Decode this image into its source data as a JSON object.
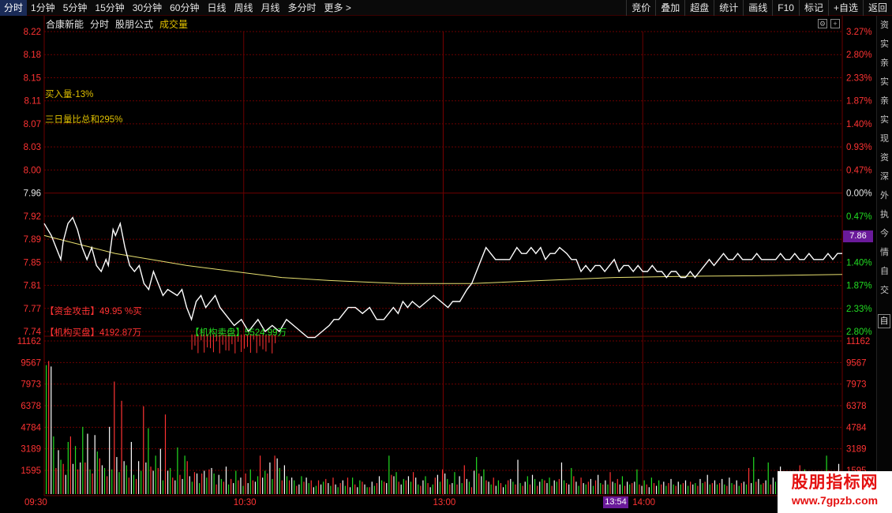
{
  "toolbar": {
    "tabs": [
      {
        "label": "分时",
        "active": true
      },
      {
        "label": "1分钟"
      },
      {
        "label": "5分钟"
      },
      {
        "label": "15分钟"
      },
      {
        "label": "30分钟"
      },
      {
        "label": "60分钟"
      },
      {
        "label": "日线"
      },
      {
        "label": "周线"
      },
      {
        "label": "月线"
      },
      {
        "label": "多分时"
      },
      {
        "label": "更多 >"
      }
    ],
    "tools": [
      "竞价",
      "叠加",
      "超盘",
      "统计",
      "画线",
      "F10",
      "标记",
      "+自选",
      "返回"
    ]
  },
  "title": {
    "stock_name": "合康新能",
    "view": "分时",
    "formula": "股朋公式",
    "indicator": "成交量"
  },
  "annotations": {
    "buy_in": "买入量-13%",
    "three_day": "三日量比总和295%",
    "fund_attack": "【资金攻击】49.95 %买",
    "inst_buy": "【机构买盘】4192.87万",
    "inst_sell": "【机构卖盘】5524.99万"
  },
  "current_price_label": "7.86",
  "cursor_time_label": "13:54",
  "right_strip_text": "资 实 亲 实 亲 实 现 资 深 外 执 今 情 自 交",
  "right_strip_tab": "自",
  "watermark": {
    "title": "股朋指标网",
    "url": "www.7gpzb.com"
  },
  "colors": {
    "background": "#000000",
    "grid": "#6b0000",
    "price_line": "#ffffff",
    "avg_line": "#e8e070",
    "up": "#ff3333",
    "down": "#22dd22",
    "label_price": "#ff3333",
    "label_ref": "#e6e6e6",
    "accent": "#6a1a9a"
  },
  "chart_data": [
    {
      "type": "line",
      "name": "price",
      "yticks_left": [
        "8.22",
        "8.18",
        "8.15",
        "8.11",
        "8.07",
        "8.03",
        "8.00",
        "7.96",
        "7.92",
        "7.89",
        "7.85",
        "7.81",
        "7.77",
        "7.74"
      ],
      "yticks_right": [
        "3.27%",
        "2.80%",
        "2.33%",
        "1.87%",
        "1.40%",
        "0.93%",
        "0.47%",
        "0.00%",
        "0.47%",
        "0.93%",
        "1.40%",
        "1.87%",
        "2.33%",
        "2.80%"
      ],
      "reference_price": 7.96,
      "ylim": [
        7.72,
        8.22
      ],
      "x_ticks": [
        "09:30",
        "10:30",
        "13:00",
        "14:00"
      ],
      "series": [
        {
          "name": "price",
          "points_minute_price": [
            [
              0,
              7.9
            ],
            [
              3,
              7.88
            ],
            [
              5,
              7.86
            ],
            [
              7,
              7.84
            ],
            [
              8,
              7.87
            ],
            [
              10,
              7.9
            ],
            [
              12,
              7.91
            ],
            [
              14,
              7.89
            ],
            [
              16,
              7.86
            ],
            [
              18,
              7.84
            ],
            [
              20,
              7.86
            ],
            [
              22,
              7.83
            ],
            [
              24,
              7.82
            ],
            [
              26,
              7.84
            ],
            [
              27,
              7.83
            ],
            [
              29,
              7.89
            ],
            [
              30,
              7.88
            ],
            [
              32,
              7.9
            ],
            [
              34,
              7.86
            ],
            [
              36,
              7.83
            ],
            [
              38,
              7.82
            ],
            [
              40,
              7.83
            ],
            [
              42,
              7.8
            ],
            [
              44,
              7.79
            ],
            [
              46,
              7.82
            ],
            [
              48,
              7.8
            ],
            [
              50,
              7.78
            ],
            [
              52,
              7.79
            ],
            [
              56,
              7.78
            ],
            [
              58,
              7.79
            ],
            [
              60,
              7.76
            ],
            [
              62,
              7.74
            ],
            [
              64,
              7.77
            ],
            [
              66,
              7.78
            ],
            [
              68,
              7.76
            ],
            [
              70,
              7.77
            ],
            [
              72,
              7.78
            ],
            [
              74,
              7.76
            ],
            [
              76,
              7.75
            ],
            [
              78,
              7.74
            ],
            [
              80,
              7.73
            ],
            [
              83,
              7.74
            ],
            [
              86,
              7.72
            ],
            [
              88,
              7.73
            ],
            [
              90,
              7.74
            ],
            [
              93,
              7.72
            ],
            [
              96,
              7.73
            ],
            [
              99,
              7.72
            ],
            [
              102,
              7.74
            ],
            [
              105,
              7.73
            ],
            [
              108,
              7.72
            ],
            [
              111,
              7.71
            ],
            [
              114,
              7.71
            ],
            [
              117,
              7.72
            ],
            [
              120,
              7.73
            ],
            [
              122,
              7.74
            ],
            [
              124,
              7.74
            ],
            [
              126,
              7.75
            ],
            [
              128,
              7.76
            ],
            [
              131,
              7.76
            ],
            [
              134,
              7.75
            ],
            [
              137,
              7.76
            ],
            [
              140,
              7.74
            ],
            [
              143,
              7.74
            ],
            [
              145,
              7.75
            ],
            [
              147,
              7.76
            ],
            [
              149,
              7.75
            ],
            [
              151,
              7.77
            ],
            [
              153,
              7.76
            ],
            [
              155,
              7.77
            ],
            [
              158,
              7.76
            ],
            [
              161,
              7.77
            ],
            [
              164,
              7.78
            ],
            [
              167,
              7.77
            ],
            [
              170,
              7.76
            ],
            [
              172,
              7.77
            ],
            [
              175,
              7.77
            ],
            [
              178,
              7.79
            ],
            [
              180,
              7.8
            ],
            [
              182,
              7.82
            ],
            [
              184,
              7.84
            ],
            [
              186,
              7.86
            ],
            [
              188,
              7.85
            ],
            [
              190,
              7.84
            ],
            [
              193,
              7.84
            ],
            [
              196,
              7.84
            ],
            [
              199,
              7.86
            ],
            [
              201,
              7.85
            ],
            [
              203,
              7.85
            ],
            [
              205,
              7.86
            ],
            [
              207,
              7.85
            ],
            [
              209,
              7.86
            ],
            [
              211,
              7.84
            ],
            [
              213,
              7.85
            ],
            [
              215,
              7.85
            ],
            [
              217,
              7.86
            ],
            [
              220,
              7.85
            ],
            [
              222,
              7.84
            ],
            [
              224,
              7.84
            ],
            [
              226,
              7.82
            ],
            [
              228,
              7.83
            ],
            [
              230,
              7.82
            ],
            [
              232,
              7.83
            ],
            [
              234,
              7.83
            ],
            [
              236,
              7.82
            ],
            [
              238,
              7.83
            ],
            [
              240,
              7.84
            ],
            [
              242,
              7.82
            ],
            [
              244,
              7.83
            ],
            [
              246,
              7.83
            ],
            [
              248,
              7.82
            ],
            [
              250,
              7.83
            ],
            [
              252,
              7.82
            ],
            [
              254,
              7.82
            ],
            [
              256,
              7.83
            ],
            [
              258,
              7.82
            ],
            [
              260,
              7.82
            ],
            [
              262,
              7.81
            ],
            [
              264,
              7.82
            ],
            [
              266,
              7.82
            ],
            [
              268,
              7.81
            ],
            [
              270,
              7.81
            ],
            [
              272,
              7.82
            ],
            [
              274,
              7.81
            ],
            [
              276,
              7.82
            ],
            [
              278,
              7.83
            ],
            [
              280,
              7.84
            ],
            [
              282,
              7.83
            ],
            [
              284,
              7.84
            ],
            [
              286,
              7.85
            ],
            [
              288,
              7.84
            ],
            [
              290,
              7.84
            ],
            [
              292,
              7.85
            ],
            [
              294,
              7.84
            ],
            [
              296,
              7.84
            ],
            [
              298,
              7.84
            ],
            [
              300,
              7.85
            ],
            [
              302,
              7.84
            ],
            [
              304,
              7.84
            ],
            [
              306,
              7.84
            ],
            [
              308,
              7.84
            ],
            [
              310,
              7.85
            ],
            [
              312,
              7.84
            ],
            [
              314,
              7.84
            ],
            [
              316,
              7.85
            ],
            [
              318,
              7.84
            ],
            [
              320,
              7.84
            ],
            [
              322,
              7.85
            ],
            [
              324,
              7.84
            ],
            [
              326,
              7.84
            ],
            [
              328,
              7.84
            ],
            [
              330,
              7.85
            ],
            [
              332,
              7.84
            ],
            [
              334,
              7.85
            ],
            [
              336,
              7.85
            ]
          ]
        },
        {
          "name": "average",
          "points_minute_price": [
            [
              0,
              7.88
            ],
            [
              10,
              7.87
            ],
            [
              20,
              7.86
            ],
            [
              30,
              7.85
            ],
            [
              45,
              7.84
            ],
            [
              60,
              7.83
            ],
            [
              80,
              7.82
            ],
            [
              100,
              7.81
            ],
            [
              120,
              7.805
            ],
            [
              150,
              7.8
            ],
            [
              180,
              7.8
            ],
            [
              210,
              7.805
            ],
            [
              240,
              7.81
            ],
            [
              270,
              7.812
            ],
            [
              300,
              7.813
            ],
            [
              336,
              7.815
            ]
          ]
        }
      ]
    },
    {
      "type": "bar",
      "name": "volume",
      "yticks": [
        "11162",
        "9567",
        "7973",
        "6378",
        "4784",
        "3189",
        "1595"
      ],
      "ylim": [
        0,
        11162
      ],
      "values": [
        9400,
        9700,
        9300,
        4200,
        1900,
        3200,
        2500,
        2200,
        1400,
        3800,
        4200,
        2200,
        3500,
        1800,
        2300,
        4900,
        2300,
        4400,
        1800,
        1500,
        4300,
        3100,
        2600,
        2100,
        1900,
        1300,
        4900,
        1800,
        8200,
        2700,
        1600,
        6800,
        2400,
        2100,
        1200,
        3800,
        1400,
        1100,
        2400,
        1700,
        6400,
        2300,
        4800,
        2000,
        1700,
        2800,
        1900,
        3300,
        1000,
        5800,
        1700,
        1900,
        1200,
        1000,
        3400,
        1400,
        1100,
        2800,
        2400,
        1300,
        900,
        1600,
        1500,
        800,
        1500,
        1700,
        1200,
        1800,
        1900,
        1500,
        700,
        1400,
        1100,
        900,
        2000,
        700,
        1100,
        800,
        1700,
        1000,
        1200,
        600,
        1500,
        800,
        1800,
        1000,
        900,
        1300,
        2800,
        1200,
        1700,
        1500,
        2300,
        1100,
        2800,
        2600,
        1900,
        1000,
        2100,
        1300,
        1000,
        1200,
        1000,
        600,
        700,
        1300,
        900,
        1200,
        800,
        1000,
        500,
        600,
        1000,
        700,
        900,
        1100,
        800,
        600,
        1200,
        700,
        500,
        800,
        1000,
        600,
        1200,
        500,
        1200,
        700,
        500,
        1000,
        900,
        700,
        500,
        500,
        900,
        600,
        800,
        1300,
        1000,
        900,
        800,
        2800,
        1400,
        1300,
        1600,
        900,
        700,
        1100,
        1000,
        1300,
        900,
        1600,
        1200,
        700,
        600,
        1000,
        1300,
        800,
        500,
        700,
        1200,
        1400,
        900,
        1800,
        1500,
        1100,
        700,
        800,
        1600,
        700,
        1300,
        800,
        2100,
        1100,
        900,
        500,
        1700,
        2700,
        1500,
        1300,
        1800,
        1000,
        900,
        700,
        1200,
        600,
        1000,
        800,
        500,
        700,
        1000,
        1100,
        900,
        700,
        2500,
        800,
        600,
        900,
        1300,
        700,
        1400,
        1100,
        600,
        900,
        1100,
        1000,
        800,
        1200,
        600,
        1000,
        900,
        1100,
        2300,
        1000,
        800,
        700,
        1900,
        1300,
        900,
        600,
        1200,
        800,
        700,
        900,
        1100,
        600,
        1000,
        1400,
        800,
        700,
        1000,
        700,
        1600,
        900,
        800,
        1100,
        700,
        1300,
        600,
        900,
        700,
        800,
        900,
        1800,
        700,
        600,
        1000,
        700,
        500,
        1200,
        800,
        600,
        1000,
        700,
        900,
        600,
        800,
        1100,
        700,
        600,
        900,
        700,
        800,
        1000,
        600,
        900,
        700,
        800,
        600,
        1100,
        800,
        900,
        1400,
        700,
        800,
        1000,
        700,
        800,
        1100,
        700,
        600,
        1200,
        800,
        700,
        1000,
        600,
        800,
        900,
        700,
        1900,
        800,
        2700,
        900,
        1100,
        700,
        800,
        1000,
        2300,
        700,
        1200,
        900,
        800,
        2000,
        1200,
        900,
        1000,
        800,
        1100,
        1200,
        800,
        2100,
        1200,
        1800,
        1500,
        1000,
        900,
        1200,
        1300,
        1600,
        1200,
        1000,
        2800,
        1700,
        1100,
        900,
        1300,
        2200
      ]
    }
  ]
}
